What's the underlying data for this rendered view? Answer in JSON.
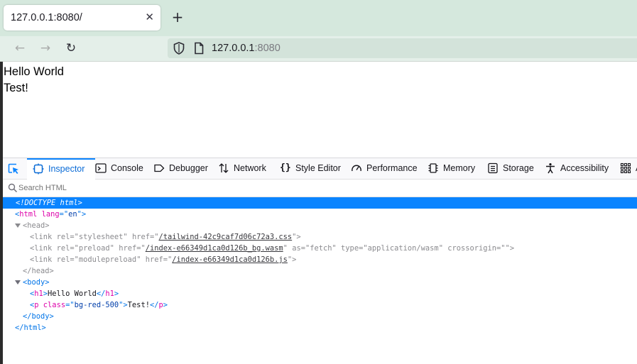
{
  "browser": {
    "tab": {
      "title": "127.0.0.1:8080/",
      "close": "✕"
    },
    "newtab": "+",
    "nav": {
      "back": "←",
      "forward": "→",
      "reload": "↻"
    },
    "url": {
      "host": "127.0.0.1",
      "port": ":8080"
    }
  },
  "page": {
    "heading": "Hello World",
    "paragraph": "Test!"
  },
  "devtools": {
    "tabs": [
      {
        "label": "Inspector"
      },
      {
        "label": "Console"
      },
      {
        "label": "Debugger"
      },
      {
        "label": "Network"
      },
      {
        "label": "Style Editor"
      },
      {
        "label": "Performance"
      },
      {
        "label": "Memory"
      },
      {
        "label": "Storage"
      },
      {
        "label": "Accessibility"
      },
      {
        "label": "A"
      }
    ],
    "search": {
      "placeholder": "Search HTML"
    },
    "markup": {
      "doctype": "<!DOCTYPE html>",
      "html_open": {
        "lt": "<",
        "tag": "html",
        "attr": "lang",
        "eq": "=\"",
        "val": "en",
        "close": "\">"
      },
      "head_open": "<head>",
      "link1": {
        "tag": "link",
        "rel": "stylesheet",
        "href": "/tailwind-42c9caf7d06c72a3.css"
      },
      "link2": {
        "tag": "link",
        "rel": "preload",
        "href": "/index-e66349d1ca0d126b_bg.wasm",
        "as": "fetch",
        "type": "application/wasm",
        "crossorigin": ""
      },
      "link3": {
        "tag": "link",
        "rel": "modulepreload",
        "href": "/index-e66349d1ca0d126b.js"
      },
      "head_close": "</head>",
      "body_open": "<body>",
      "h1": {
        "tag": "h1",
        "text": "Hello World"
      },
      "p": {
        "tag": "p",
        "attr": "class",
        "val": "bg-red-500",
        "text": "Test!"
      },
      "body_close": "</body>",
      "html_close": "</html>"
    }
  },
  "colors": {
    "accent": "#0a84ff",
    "tabstrip": "#d5e8dd",
    "navbar": "#e4efe9"
  }
}
